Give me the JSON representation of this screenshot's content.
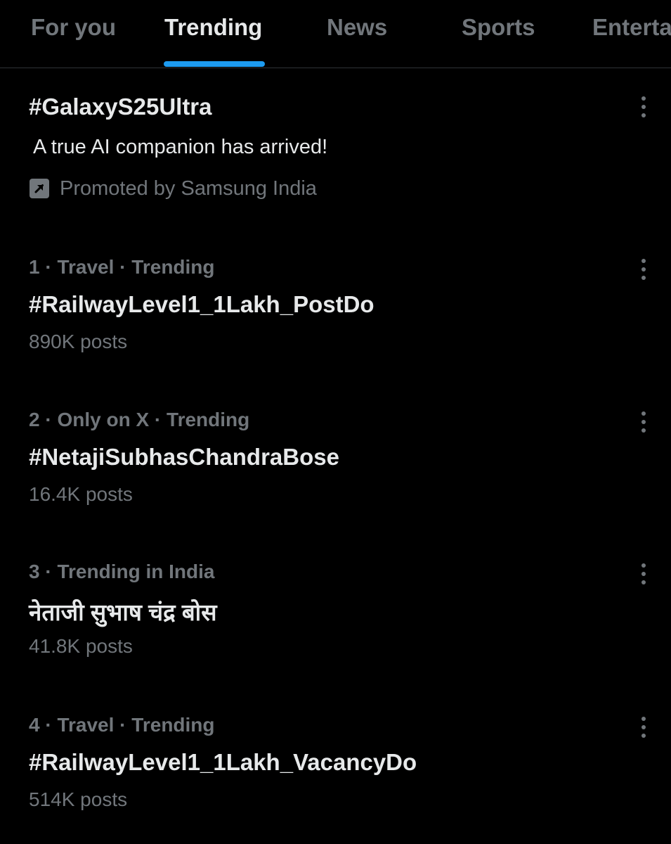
{
  "tabs": [
    {
      "label": "For you",
      "active": false
    },
    {
      "label": "Trending",
      "active": true
    },
    {
      "label": "News",
      "active": false
    },
    {
      "label": "Sports",
      "active": false
    },
    {
      "label": "Entertainment",
      "active": false
    }
  ],
  "colors": {
    "background": "#000000",
    "primary_text": "#e7e9ea",
    "secondary_text": "#71767b",
    "accent": "#1d9bf0",
    "divider": "#2f3336"
  },
  "promoted": {
    "title": "#GalaxyS25Ultra",
    "description": "A true AI companion has arrived!",
    "promoted_by": "Promoted by Samsung India",
    "icon": "promoted-arrow-icon"
  },
  "trends": [
    {
      "meta": "1 · Travel · Trending",
      "title": "#RailwayLevel1_1Lakh_PostDo",
      "count": "890K posts"
    },
    {
      "meta": "2 · Only on X · Trending",
      "title": "#NetajiSubhasChandraBose",
      "count": "16.4K posts"
    },
    {
      "meta": "3 · Trending in India",
      "title": "नेताजी सुभाष चंद्र बोस",
      "count": "41.8K posts"
    },
    {
      "meta": "4 · Travel · Trending",
      "title": "#RailwayLevel1_1Lakh_VacancyDo",
      "count": "514K posts"
    }
  ]
}
